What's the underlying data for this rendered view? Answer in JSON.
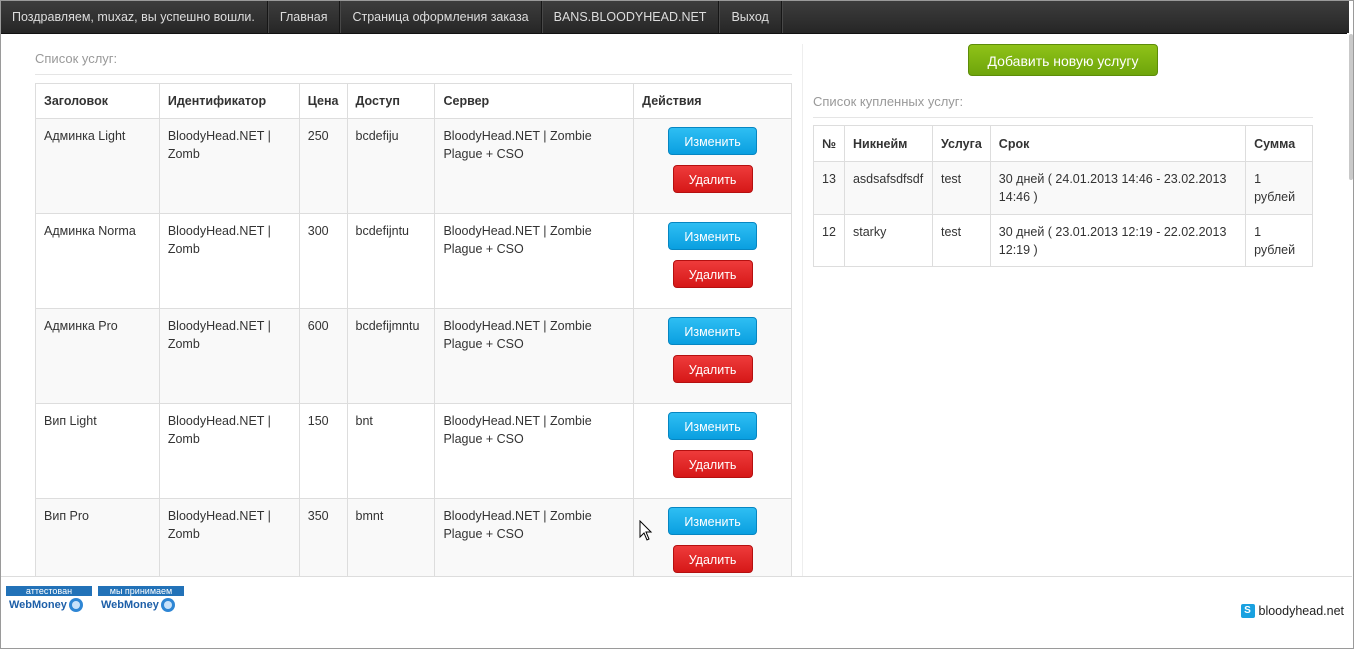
{
  "navbar": {
    "greeting": "Поздравляем, muxaz, вы успешно вошли.",
    "items": [
      "Главная",
      "Страница оформления заказа",
      "BANS.BLOODYHEAD.NET",
      "Выход"
    ]
  },
  "services": {
    "title": "Список услуг:",
    "columns": [
      "Заголовок",
      "Идентификатор",
      "Цена",
      "Доступ",
      "Сервер",
      "Действия"
    ],
    "edit_label": "Изменить",
    "delete_label": "Удалить",
    "rows": [
      {
        "title": "Админка Light",
        "id": "BloodyHead.NET | Zomb",
        "price": "250",
        "access": "bcdefiju",
        "server": "BloodyHead.NET | Zombie Plague + CSO"
      },
      {
        "title": "Админка Norma",
        "id": "BloodyHead.NET | Zomb",
        "price": "300",
        "access": "bcdefijntu",
        "server": "BloodyHead.NET | Zombie Plague + CSO"
      },
      {
        "title": "Админка Pro",
        "id": "BloodyHead.NET | Zomb",
        "price": "600",
        "access": "bcdefijmntu",
        "server": "BloodyHead.NET | Zombie Plague + CSO"
      },
      {
        "title": "Вип Light",
        "id": "BloodyHead.NET | Zomb",
        "price": "150",
        "access": "bnt",
        "server": "BloodyHead.NET | Zombie Plague + CSO"
      },
      {
        "title": "Вип Pro",
        "id": "BloodyHead.NET | Zomb",
        "price": "350",
        "access": "bmnt",
        "server": "BloodyHead.NET | Zombie Plague + CSO"
      }
    ]
  },
  "add_button": "Добавить новую услугу",
  "purchased": {
    "title": "Список купленных услуг:",
    "columns": [
      "№",
      "Никнейм",
      "Услуга",
      "Срок",
      "Сумма"
    ],
    "rows": [
      {
        "num": "13",
        "nick": "asdsafsdfsdf",
        "service": "test",
        "term": "30 дней ( 24.01.2013 14:46 - 23.02.2013 14:46 )",
        "sum": "1 рублей"
      },
      {
        "num": "12",
        "nick": "starky",
        "service": "test",
        "term": "30 дней ( 23.01.2013 12:19 - 22.02.2013 12:19 )",
        "sum": "1 рублей"
      }
    ]
  },
  "footer": {
    "badges": [
      {
        "top": "аттестован",
        "bottom": "WebMoney"
      },
      {
        "top": "мы принимаем",
        "bottom": "WebMoney"
      }
    ],
    "site": "bloodyhead.net"
  }
}
